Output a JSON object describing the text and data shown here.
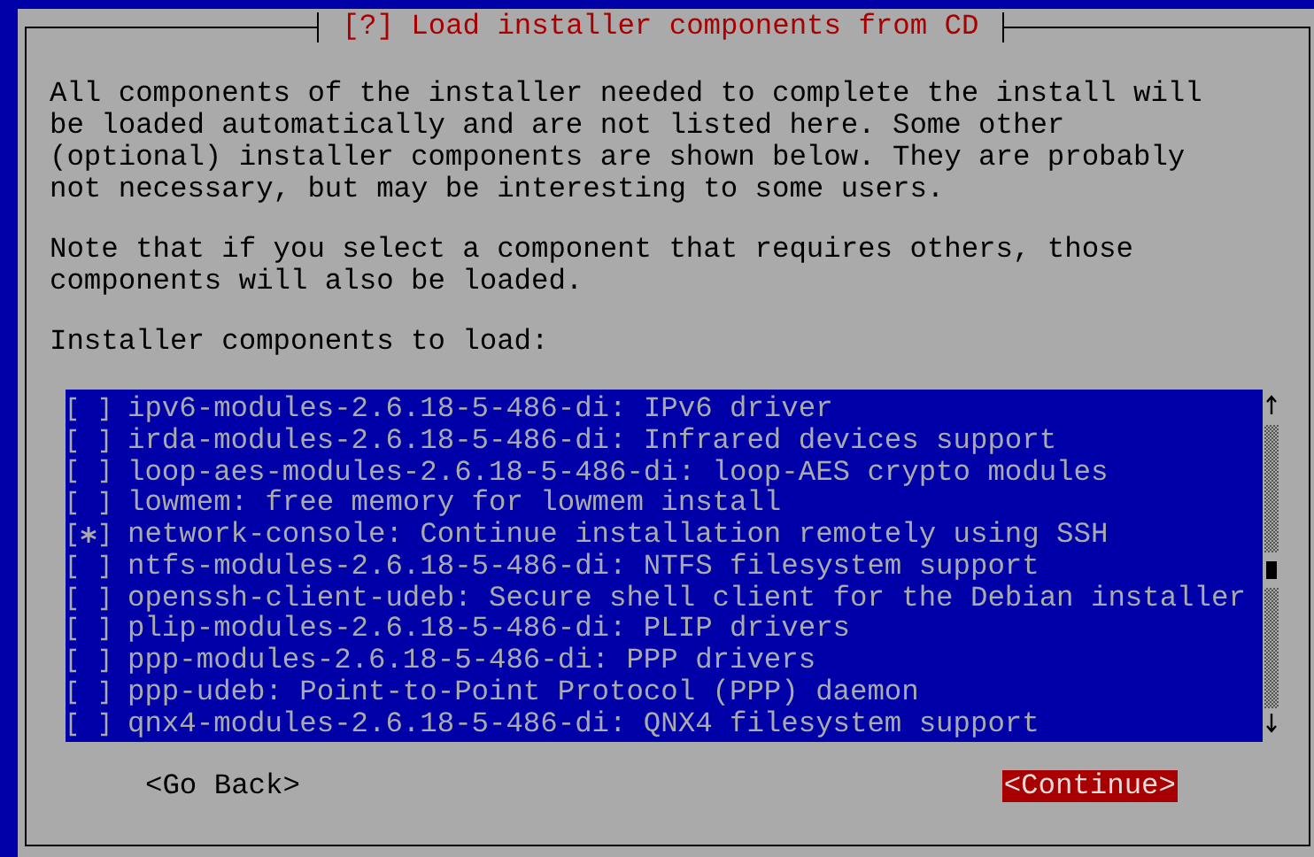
{
  "dialog": {
    "title": "[?] Load installer components from CD",
    "paragraphs": [
      "All components of the installer needed to complete the install will be loaded automatically and are not listed here. Some other (optional) installer components are shown below. They are probably not necessary, but may be interesting to some users.",
      "Note that if you select a component that requires others, those components will also be loaded."
    ],
    "list_label": "Installer components to load:",
    "components": [
      {
        "label": "ipv6-modules-2.6.18-5-486-di: IPv6 driver",
        "checked": false
      },
      {
        "label": "irda-modules-2.6.18-5-486-di: Infrared devices support",
        "checked": false
      },
      {
        "label": "loop-aes-modules-2.6.18-5-486-di: loop-AES crypto modules",
        "checked": false
      },
      {
        "label": "lowmem: free memory for lowmem install",
        "checked": false
      },
      {
        "label": "network-console: Continue installation remotely using SSH",
        "checked": true
      },
      {
        "label": "ntfs-modules-2.6.18-5-486-di: NTFS filesystem support",
        "checked": false
      },
      {
        "label": "openssh-client-udeb: Secure shell client for the Debian installer",
        "checked": false
      },
      {
        "label": "plip-modules-2.6.18-5-486-di: PLIP drivers",
        "checked": false
      },
      {
        "label": "ppp-modules-2.6.18-5-486-di: PPP drivers",
        "checked": false
      },
      {
        "label": "ppp-udeb: Point-to-Point Protocol (PPP) daemon",
        "checked": false
      },
      {
        "label": "qnx4-modules-2.6.18-5-486-di: QNX4 filesystem support",
        "checked": false
      }
    ],
    "buttons": [
      {
        "label": "<Go Back>",
        "selected": false
      },
      {
        "label": "<Continue>",
        "selected": true
      }
    ]
  }
}
